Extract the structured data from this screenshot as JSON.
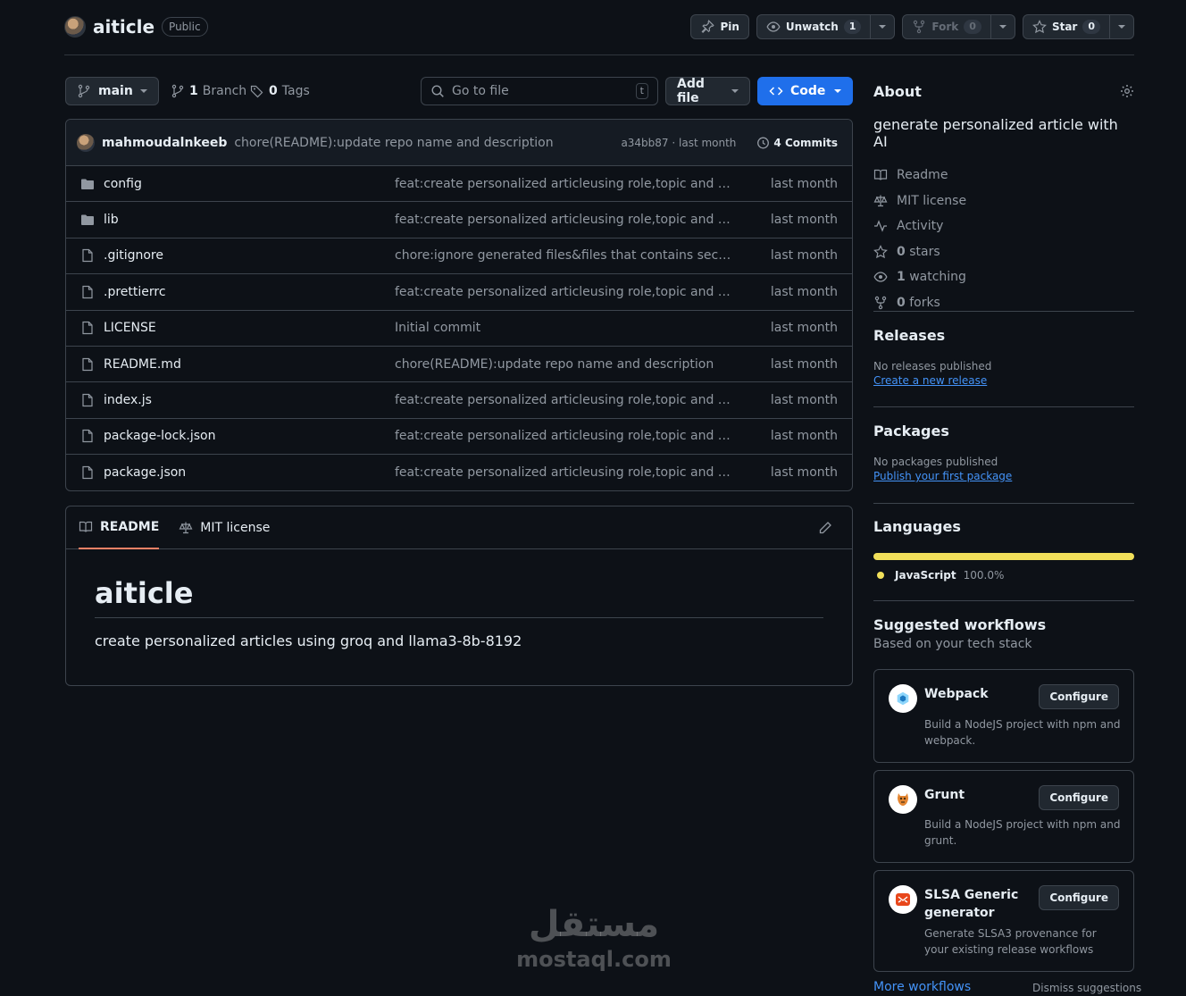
{
  "repo": {
    "name": "aiticle",
    "visibility": "Public"
  },
  "actions": {
    "pin": "Pin",
    "unwatch": "Unwatch",
    "watch_count": "1",
    "fork": "Fork",
    "fork_count": "0",
    "star": "Star",
    "star_count": "0"
  },
  "toolbar": {
    "branch": "main",
    "branch_count": "1",
    "branch_label": "Branch",
    "tag_count": "0",
    "tag_label": "Tags",
    "search_placeholder": "Go to file",
    "search_kbd": "t",
    "add_file": "Add file",
    "code": "Code"
  },
  "commit": {
    "author": "mahmoudalnkeeb",
    "message": "chore(README):update repo name and description",
    "hash_time": "a34bb87 · last month",
    "count": "4 Commits"
  },
  "files": [
    {
      "type": "dir",
      "name": "config",
      "message": "feat:create personalized articleusing role,topic and custo...",
      "time": "last month"
    },
    {
      "type": "dir",
      "name": "lib",
      "message": "feat:create personalized articleusing role,topic and custo...",
      "time": "last month"
    },
    {
      "type": "file",
      "name": ".gitignore",
      "message": "chore:ignore generated files&files that contains secrets",
      "time": "last month"
    },
    {
      "type": "file",
      "name": ".prettierrc",
      "message": "feat:create personalized articleusing role,topic and custo...",
      "time": "last month"
    },
    {
      "type": "file",
      "name": "LICENSE",
      "message": "Initial commit",
      "time": "last month"
    },
    {
      "type": "file",
      "name": "README.md",
      "message": "chore(README):update repo name and description",
      "time": "last month"
    },
    {
      "type": "file",
      "name": "index.js",
      "message": "feat:create personalized articleusing role,topic and custo...",
      "time": "last month"
    },
    {
      "type": "file",
      "name": "package-lock.json",
      "message": "feat:create personalized articleusing role,topic and custo...",
      "time": "last month"
    },
    {
      "type": "file",
      "name": "package.json",
      "message": "feat:create personalized articleusing role,topic and custo...",
      "time": "last month"
    }
  ],
  "readme": {
    "tab_readme": "README",
    "tab_license": "MIT license",
    "title": "aiticle",
    "body": "create personalized articles using groq and llama3-8b-8192"
  },
  "about": {
    "heading": "About",
    "description": "generate personalized article with AI",
    "readme": "Readme",
    "license": "MIT license",
    "activity": "Activity",
    "stars_count": "0",
    "stars_label": "stars",
    "watching_count": "1",
    "watching_label": "watching",
    "forks_count": "0",
    "forks_label": "forks"
  },
  "releases": {
    "heading": "Releases",
    "empty": "No releases published",
    "link": "Create a new release"
  },
  "packages": {
    "heading": "Packages",
    "empty": "No packages published",
    "link": "Publish your first package"
  },
  "languages": {
    "heading": "Languages",
    "name": "JavaScript",
    "percent": "100.0%",
    "color": "#f1e05a"
  },
  "workflows": {
    "heading": "Suggested workflows",
    "subheading": "Based on your tech stack",
    "configure": "Configure",
    "items": [
      {
        "name": "Webpack",
        "description": "Build a NodeJS project with npm and webpack."
      },
      {
        "name": "Grunt",
        "description": "Build a NodeJS project with npm and grunt."
      },
      {
        "name": "SLSA Generic generator",
        "description": "Generate SLSA3 provenance for your existing release workflows"
      }
    ],
    "more": "More workflows",
    "dismiss": "Dismiss suggestions"
  },
  "watermark": {
    "arabic": "مستقل",
    "latin": "mostaql.com"
  },
  "colors": {
    "accent": "#1f6feb",
    "link": "#4493f8",
    "bg": "#0d1117",
    "border": "#3d444d"
  }
}
